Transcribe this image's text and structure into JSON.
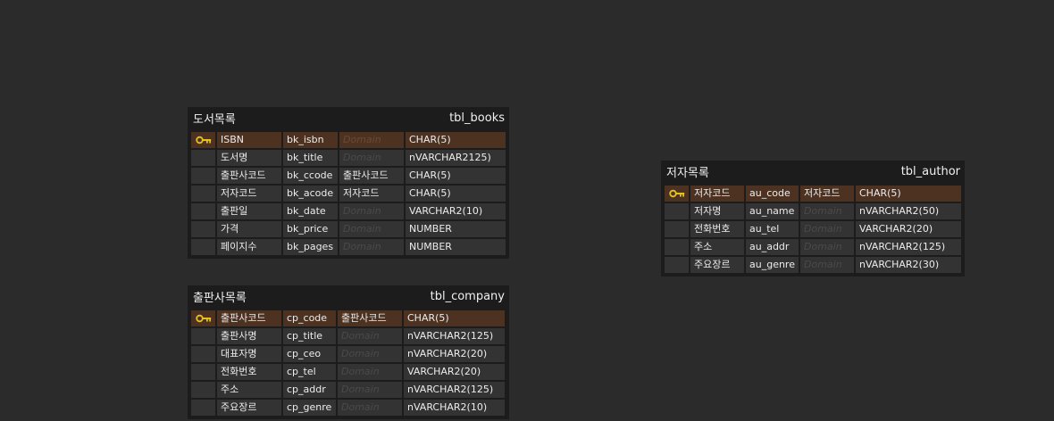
{
  "colors": {
    "background": "#2b2b2b",
    "entity_bg": "#1c1c1c",
    "row_bg": "#333333",
    "pk_row_bg": "#4d3221",
    "key_icon": "#e6c21f"
  },
  "entities": {
    "books": {
      "logical_name": "도서목록",
      "physical_name": "tbl_books",
      "rows": [
        {
          "pk": true,
          "attr": "ISBN",
          "column": "bk_isbn",
          "domain": "Domain",
          "domain_set": false,
          "type": "CHAR(5)"
        },
        {
          "pk": false,
          "attr": "도서명",
          "column": "bk_title",
          "domain": "Domain",
          "domain_set": false,
          "type": "nVARCHAR2125)"
        },
        {
          "pk": false,
          "attr": "출판사코드",
          "column": "bk_ccode",
          "domain": "출판사코드",
          "domain_set": true,
          "type": "CHAR(5)"
        },
        {
          "pk": false,
          "attr": "저자코드",
          "column": "bk_acode",
          "domain": "저자코드",
          "domain_set": true,
          "type": "CHAR(5)"
        },
        {
          "pk": false,
          "attr": "출판일",
          "column": "bk_date",
          "domain": "Domain",
          "domain_set": false,
          "type": "VARCHAR2(10)"
        },
        {
          "pk": false,
          "attr": "가격",
          "column": "bk_price",
          "domain": "Domain",
          "domain_set": false,
          "type": "NUMBER"
        },
        {
          "pk": false,
          "attr": "페이지수",
          "column": "bk_pages",
          "domain": "Domain",
          "domain_set": false,
          "type": "NUMBER"
        }
      ]
    },
    "company": {
      "logical_name": "출판사목록",
      "physical_name": "tbl_company",
      "rows": [
        {
          "pk": true,
          "attr": "출판사코드",
          "column": "cp_code",
          "domain": "출판사코드",
          "domain_set": true,
          "type": "CHAR(5)"
        },
        {
          "pk": false,
          "attr": "출판사명",
          "column": "cp_title",
          "domain": "Domain",
          "domain_set": false,
          "type": "nVARCHAR2(125)"
        },
        {
          "pk": false,
          "attr": "대표자명",
          "column": "cp_ceo",
          "domain": "Domain",
          "domain_set": false,
          "type": "nVARCHAR2(20)"
        },
        {
          "pk": false,
          "attr": "전화번호",
          "column": "cp_tel",
          "domain": "Domain",
          "domain_set": false,
          "type": "VARCHAR2(20)"
        },
        {
          "pk": false,
          "attr": "주소",
          "column": "cp_addr",
          "domain": "Domain",
          "domain_set": false,
          "type": "nVARCHAR2(125)"
        },
        {
          "pk": false,
          "attr": "주요장르",
          "column": "cp_genre",
          "domain": "Domain",
          "domain_set": false,
          "type": "nVARCHAR2(10)"
        }
      ]
    },
    "author": {
      "logical_name": "저자목록",
      "physical_name": "tbl_author",
      "rows": [
        {
          "pk": true,
          "attr": "저자코드",
          "column": "au_code",
          "domain": "저자코드",
          "domain_set": true,
          "type": "CHAR(5)"
        },
        {
          "pk": false,
          "attr": "저자명",
          "column": "au_name",
          "domain": "Domain",
          "domain_set": false,
          "type": "nVARCHAR2(50)"
        },
        {
          "pk": false,
          "attr": "전화번호",
          "column": "au_tel",
          "domain": "Domain",
          "domain_set": false,
          "type": "VARCHAR2(20)"
        },
        {
          "pk": false,
          "attr": "주소",
          "column": "au_addr",
          "domain": "Domain",
          "domain_set": false,
          "type": "nVARCHAR2(125)"
        },
        {
          "pk": false,
          "attr": "주요장르",
          "column": "au_genre",
          "domain": "Domain",
          "domain_set": false,
          "type": "nVARCHAR2(30)"
        }
      ]
    }
  }
}
